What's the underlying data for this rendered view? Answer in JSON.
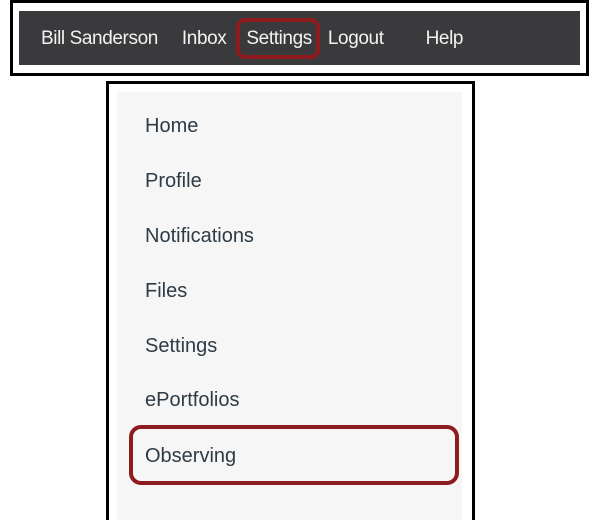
{
  "topbar": {
    "user_name": "Bill Sanderson",
    "inbox_label": "Inbox",
    "settings_label": "Settings",
    "logout_label": "Logout",
    "help_label": "Help",
    "highlighted_item": "Settings",
    "background_color": "#3a3a3c",
    "text_color": "#f2f2f2"
  },
  "settings_menu": {
    "items": [
      {
        "label": "Home"
      },
      {
        "label": "Profile"
      },
      {
        "label": "Notifications"
      },
      {
        "label": "Files"
      },
      {
        "label": "Settings"
      },
      {
        "label": "ePortfolios"
      },
      {
        "label": "Observing"
      }
    ],
    "highlighted_item": "Observing",
    "background_color": "#f6f6f6",
    "text_color": "#2d3b45"
  },
  "highlight_color": "#8e1b1e"
}
